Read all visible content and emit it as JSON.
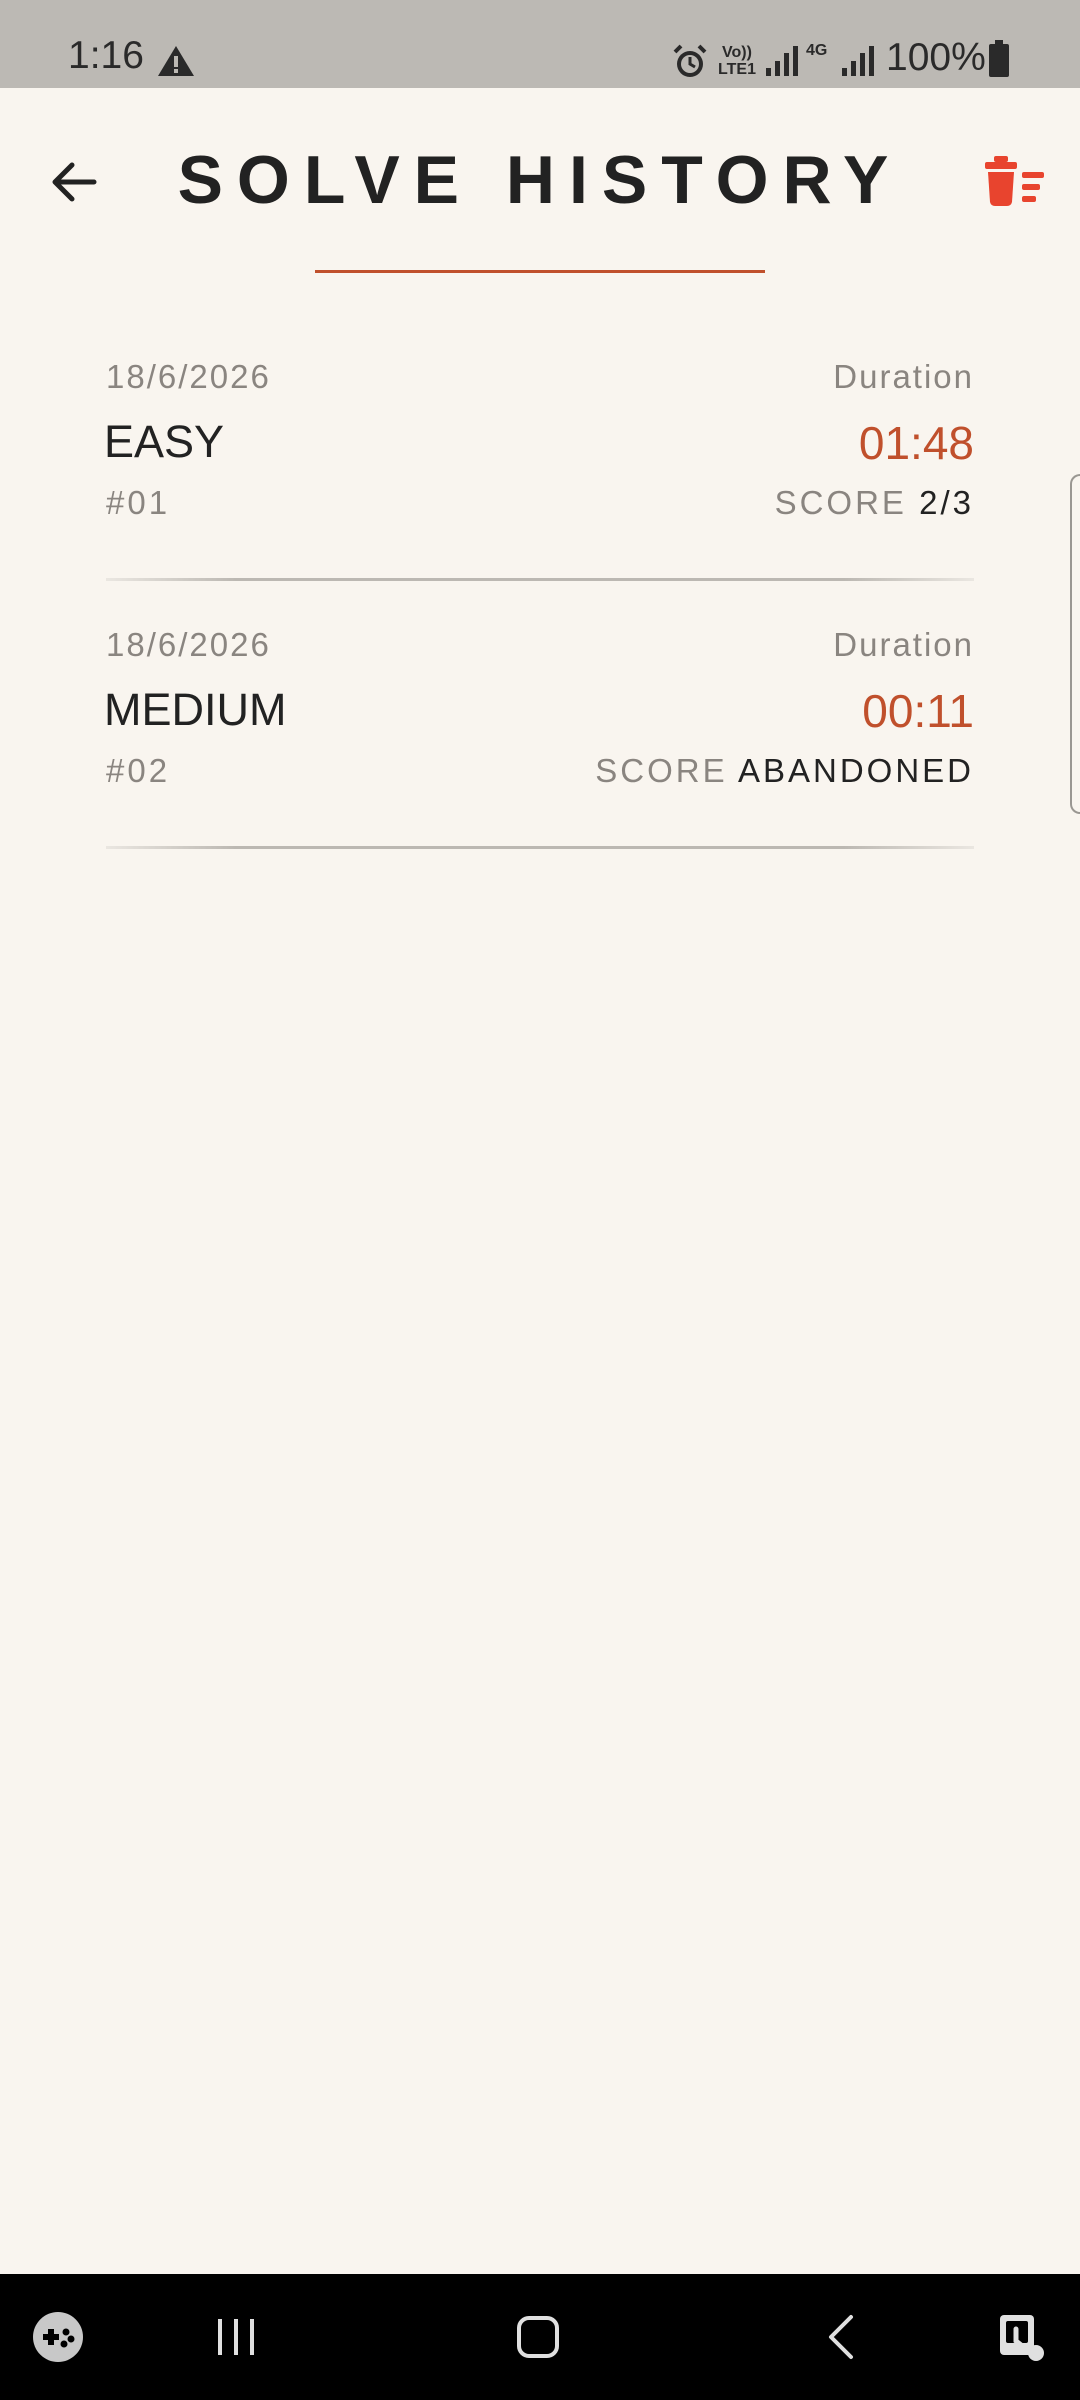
{
  "status_bar": {
    "time": "1:16",
    "lte_label": "Vo)) LTE1",
    "network_label": "4G",
    "battery": "100%"
  },
  "header": {
    "title": "SOLVE HISTORY",
    "accent_color": "#c0502c"
  },
  "history": [
    {
      "date": "18/6/2026",
      "difficulty": "EASY",
      "number": "#01",
      "duration_label": "Duration",
      "duration": "01:48",
      "score_label": "SCORE",
      "score": "2/3"
    },
    {
      "date": "18/6/2026",
      "difficulty": "MEDIUM",
      "number": "#02",
      "duration_label": "Duration",
      "duration": "00:11",
      "score_label": "SCORE",
      "score": "ABANDONED"
    }
  ],
  "icons": {
    "back": "arrow-left-icon",
    "delete": "trash-icon",
    "nav_game": "game-launcher-icon",
    "nav_recents": "recents-icon",
    "nav_home": "home-icon",
    "nav_back": "back-icon",
    "nav_assistant": "assistant-icon"
  }
}
